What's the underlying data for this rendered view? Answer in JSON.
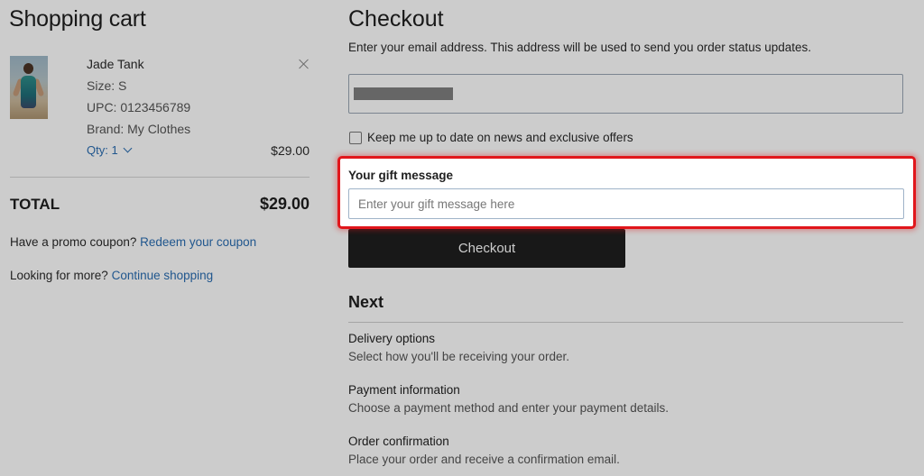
{
  "cart": {
    "title": "Shopping cart",
    "item": {
      "name": "Jade Tank",
      "size": "Size: S",
      "upc": "UPC: 0123456789",
      "brand": "Brand: My Clothes",
      "quantity_label": "Qty: 1",
      "price": "$29.00",
      "image_icon": "product-photo"
    },
    "total_label": "TOTAL",
    "total_value": "$29.00",
    "promo_text": "Have a promo coupon?",
    "promo_link": "Redeem your coupon",
    "more_text": "Looking for more?",
    "more_link": "Continue shopping"
  },
  "checkout": {
    "title": "Checkout",
    "email_instructions": "Enter your email address. This address will be used to send you order status updates.",
    "email_value_redacted": true,
    "newsletter_label": "Keep me up to date on news and exclusive offers",
    "newsletter_checked": false,
    "gift_label": "Your gift message",
    "gift_placeholder": "Enter your gift message here",
    "button_label": "Checkout"
  },
  "next": {
    "heading": "Next",
    "steps": [
      {
        "title": "Delivery options",
        "desc": "Select how you'll be receiving your order."
      },
      {
        "title": "Payment information",
        "desc": "Choose a payment method and enter your payment details."
      },
      {
        "title": "Order confirmation",
        "desc": "Place your order and receive a confirmation email."
      }
    ]
  },
  "colors": {
    "link": "#2a6db2",
    "highlight": "#e1161b",
    "button_bg": "#1f1f1f"
  }
}
